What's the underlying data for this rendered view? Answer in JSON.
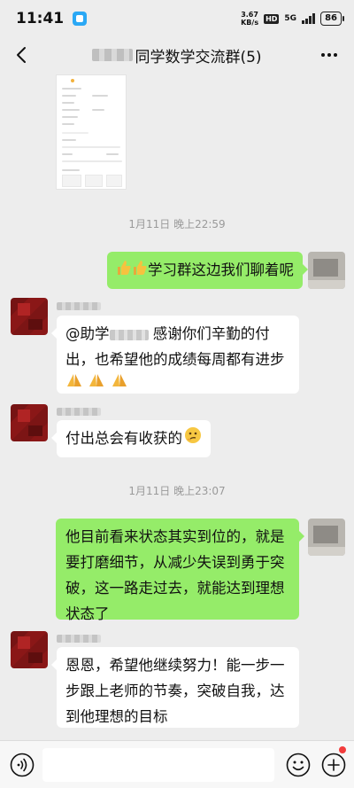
{
  "status_bar": {
    "time": "11:41",
    "speed_value": "3.67",
    "speed_unit": "KB/s",
    "hd": "HD",
    "network": "5G",
    "battery": "86"
  },
  "header": {
    "title": "同学数学交流群(5)"
  },
  "timestamps": [
    "1月11日 晚上22:59",
    "1月11日 晚上23:07"
  ],
  "messages": {
    "m1": {
      "text": "学习群这边我们聊着呢"
    },
    "m2": {
      "prefix": "@助学",
      "line1_rest": "感谢你们辛勤的付",
      "line2": "出，也希望他的成绩每周都有进步"
    },
    "m3": {
      "text": "付出总会有收获的"
    },
    "m4": {
      "lines": [
        "他目前看来状态其实到位的，就是",
        "要打磨细节，从减少失误到勇于突",
        "破，这一路走过去，就能达到理想",
        "状态了"
      ]
    },
    "m5": {
      "lines": [
        "恩恩，希望他继续努力！能一步一",
        "步跟上老师的节奏，突破自我，达",
        "到他理想的目标"
      ]
    }
  },
  "icons": {
    "back": "chevron-left-icon",
    "more": "more-dots-icon",
    "voice": "voice-icon",
    "emoji": "emoji-icon",
    "plus": "plus-icon",
    "thumbs": "thumbs-up-emoji",
    "pray": "pray-emoji",
    "thinking": "thinking-emoji"
  },
  "colors": {
    "outgoing_bubble": "#95ec69",
    "incoming_bubble": "#ffffff",
    "background": "#ededed"
  }
}
